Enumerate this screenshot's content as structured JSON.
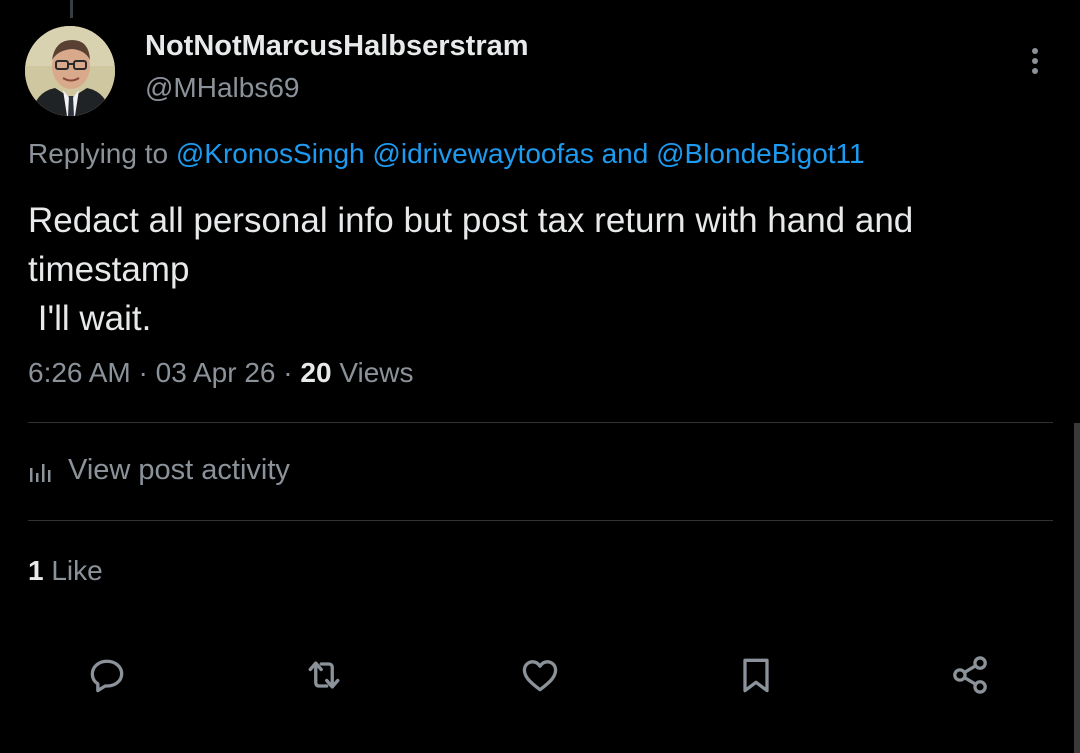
{
  "author": {
    "display_name": "NotNotMarcusHalbserstram",
    "handle": "@MHalbs69"
  },
  "reply": {
    "prefix": "Replying to ",
    "mention_1": "@KronosSingh",
    "mention_2": "@idrivewaytoofas",
    "joiner": " and ",
    "mention_3": "@BlondeBigot11"
  },
  "tweet": {
    "line_1": "Redact all personal info but post tax return with hand and",
    "line_2": "timestamp",
    "line_3": " I'll wait."
  },
  "meta": {
    "time": "6:26 AM",
    "sep_1": " · ",
    "date": "03 Apr 26",
    "sep_2": " · ",
    "views_count": "20",
    "views_label": " Views"
  },
  "activity": {
    "label": "View post activity"
  },
  "likes": {
    "count": "1",
    "label": " Like"
  },
  "actions": {
    "icons": [
      "reply-icon",
      "retweet-icon",
      "like-icon",
      "bookmark-icon",
      "share-icon"
    ]
  },
  "colors": {
    "background": "#000000",
    "primary_text": "#e7e9ea",
    "secondary_text": "#8b9299",
    "mention": "#1d9bf0",
    "divider": "#2f3336"
  }
}
